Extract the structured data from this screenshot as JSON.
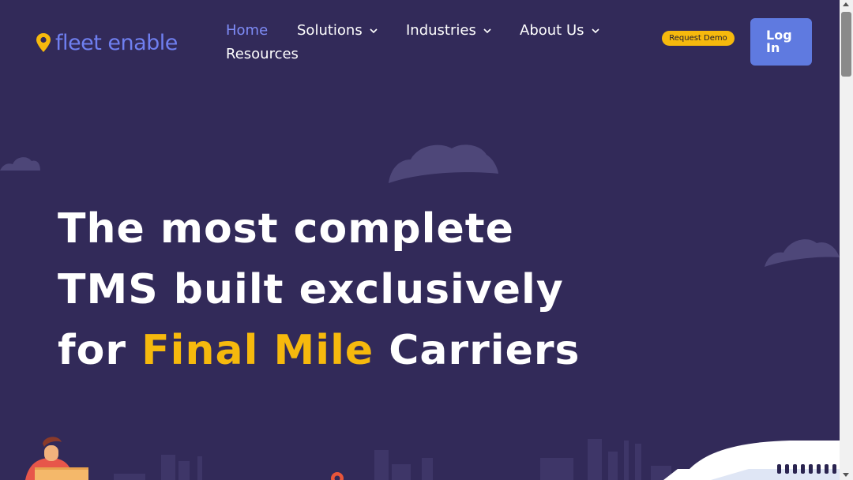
{
  "brand": {
    "name": "fleet enable",
    "colors": {
      "background": "#322a59",
      "accent": "#f6b90d",
      "brand_blue": "#6f7ff0",
      "login_blue": "#5f7ae0"
    }
  },
  "nav": {
    "home": "Home",
    "solutions": "Solutions",
    "industries": "Industries",
    "about": "About Us",
    "resources": "Resources"
  },
  "header": {
    "request_demo": "Request Demo",
    "login_line1": "Log",
    "login_line2": "In"
  },
  "hero": {
    "line1": "The most complete",
    "line2": "TMS built exclusively",
    "line3_prefix": "for",
    "line3_accent": "Final Mile",
    "line3_suffix": "Carriers"
  },
  "icons": [
    "location-pin-icon",
    "chevron-down-icon",
    "cloud-decoration",
    "city-skyline-illustration",
    "delivery-person-illustration",
    "airplane-illustration"
  ]
}
